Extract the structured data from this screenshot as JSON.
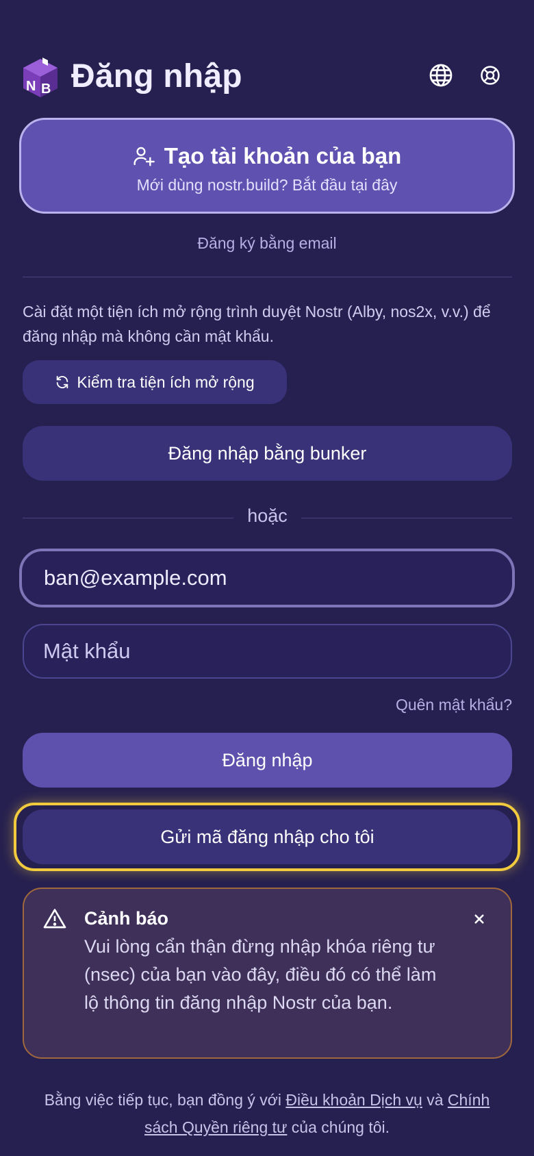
{
  "header": {
    "title": "Đăng nhập",
    "logo_icon": "nostr-build-cube-logo",
    "language_icon": "globe-icon",
    "help_icon": "lifebuoy-icon"
  },
  "create_account": {
    "title": "Tạo tài khoản của bạn",
    "subtitle": "Mới dùng nostr.build? Bắt đầu tại đây",
    "icon": "user-plus-icon"
  },
  "email_signup_link": "Đăng ký bằng email",
  "extension": {
    "description": "Cài đặt một tiện ích mở rộng trình duyệt Nostr (Alby, nos2x, v.v.) để đăng nhập mà không cần mật khẩu.",
    "check_button": "Kiểm tra tiện ích mở rộng"
  },
  "bunker_button": "Đăng nhập bằng bunker",
  "or_label": "hoặc",
  "form": {
    "email_value": "ban@example.com",
    "password_placeholder": "Mật khẩu",
    "forgot_link": "Quên mật khẩu?",
    "login_button": "Đăng nhập",
    "send_code_button": "Gửi mã đăng nhập cho tôi"
  },
  "warning": {
    "title": "Cảnh báo",
    "text": "Vui lòng cẩn thận đừng nhập khóa riêng tư (nsec) của bạn vào đây, điều đó có thể làm lộ thông tin đăng nhập Nostr của bạn."
  },
  "footer": {
    "prefix": "Bằng việc tiếp tục, bạn đồng ý với ",
    "terms_link": "Điều khoản Dịch vụ",
    "middle": " và ",
    "privacy_link": "Chính sách Quyền riêng tư",
    "suffix": " của chúng tôi."
  },
  "colors": {
    "background": "#262050",
    "primary_button": "#5d51ad",
    "secondary_button": "#3a3278",
    "highlight": "#f1cb3d",
    "warning_border": "#a0683c"
  }
}
